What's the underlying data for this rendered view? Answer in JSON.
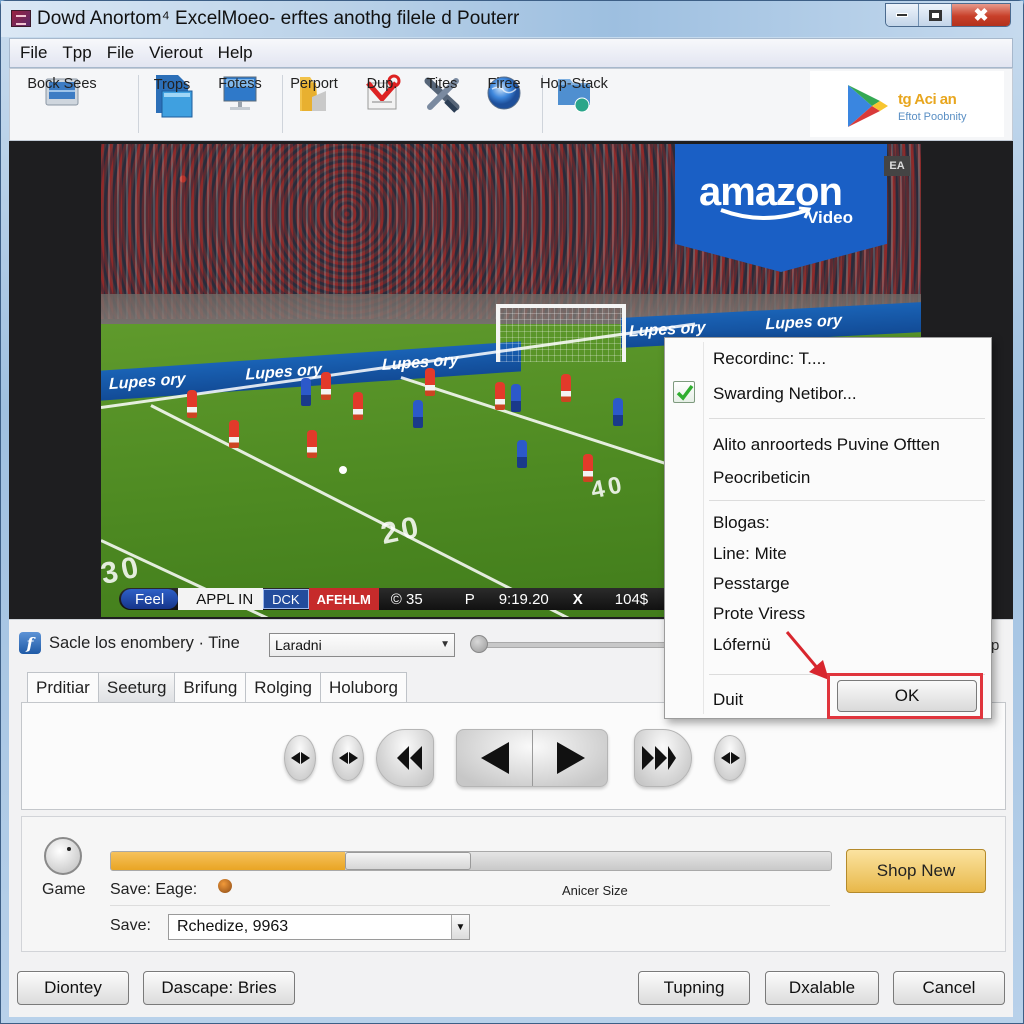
{
  "window": {
    "title": "Dowd Anortom⁴ ExcelMoeo- erftes anothg filele d Pouterr",
    "controls": {
      "minimize": "minimize-icon",
      "maximize": "maximize-icon",
      "close": "✖"
    }
  },
  "menu": [
    "File",
    "Tpp",
    "File",
    "Vierout",
    "Help"
  ],
  "toolbar": {
    "items": [
      {
        "label": "Bock Sees",
        "icon": "monitor-panel-icon"
      },
      {
        "label": "Trops",
        "icon": "documents-icon"
      },
      {
        "label": "Fotess",
        "icon": "monitor-icon"
      },
      {
        "label": "Perport",
        "icon": "folder-icon"
      },
      {
        "label": "Dup.",
        "icon": "gmail-icon"
      },
      {
        "label": "Tites",
        "icon": "tools-icon"
      },
      {
        "label": "Firee",
        "icon": "globe-icon"
      },
      {
        "label": "Hop-Stack",
        "icon": "network-folder-icon"
      }
    ],
    "brand": {
      "line1": "tg Aci an",
      "line2": "Eftot Poobnity"
    }
  },
  "video": {
    "overlay_brand": "amazon",
    "overlay_sub": "Video",
    "corner_tag": "EA",
    "ad_text": "Lupes ory",
    "yard_numbers": [
      "30",
      "20",
      "40"
    ],
    "scorebar": {
      "team1": "Feel",
      "team1_name": "APPL IN",
      "blue_tag": "DCK",
      "red_tag": "AFEHLM",
      "score": "© 35",
      "period": "P",
      "clock": "9:19.20",
      "x_mark": "X",
      "right_value": "104$"
    }
  },
  "controls": {
    "scale_label": "Sacle los enombery · Tine",
    "scale_select": "Laradni",
    "tabs": [
      {
        "label": "Prditiar",
        "active": false
      },
      {
        "label": "Seeturg",
        "active": true
      },
      {
        "label": "Brifung",
        "active": false
      },
      {
        "label": "Rolging",
        "active": false
      },
      {
        "label": "Holuborg",
        "active": false
      }
    ],
    "game_label": "Game",
    "save_eage_label": "Save:  Eage:",
    "progress_fraction": 0.325,
    "progress_thumb_end": 0.5,
    "size_label": "Anicer Size",
    "shop_button": "Shop New",
    "save_label": "Save:",
    "save_value": "Rchedize, 9963"
  },
  "popup": {
    "items": [
      {
        "label": "Recordinc: T....",
        "checked": false
      },
      {
        "label": "Swarding  Netibor...",
        "checked": true
      },
      {
        "label": "Alito anroorteds Puvine Oftten",
        "checked": false
      },
      {
        "label": "Peocribeticin",
        "checked": false
      },
      {
        "label": "Blogas:",
        "checked": false
      },
      {
        "label": "Line: Mite",
        "checked": false
      },
      {
        "label": "Pesstarge",
        "checked": false
      },
      {
        "label": "Prote Viress",
        "checked": false
      },
      {
        "label": "Lófernü",
        "checked": false
      },
      {
        "label": "Duit",
        "checked": false
      }
    ],
    "ok_button": "OK",
    "annotation_color": "#e0353d"
  },
  "bottom_buttons": [
    "Diontey",
    "Dascape: Bries",
    "Tupning",
    "Dxalable",
    "Cancel"
  ],
  "colors": {
    "accent_orange": "#e9a524",
    "highlight_red": "#e0353d",
    "amazon_blue": "#1a5fc5",
    "checkmark_green": "#2fae2f"
  }
}
